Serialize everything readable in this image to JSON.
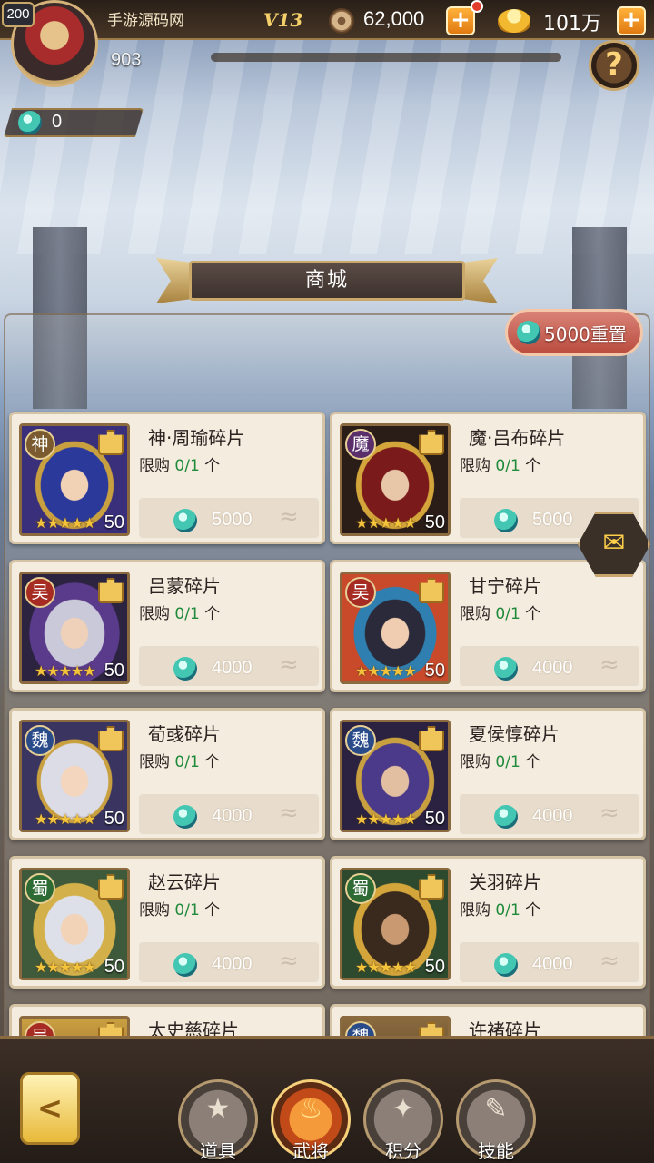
{
  "header": {
    "level": "200",
    "player_name": "手游源码网",
    "vip": "V13",
    "coins": "62,000",
    "ingots": "101万",
    "power": "903",
    "help_label": "?",
    "jade_balance": "0"
  },
  "title": "商城",
  "reset_button": "5000重置",
  "cards": [
    {
      "name": "神·周瑜碎片",
      "faction": "神",
      "limit_prefix": "限购",
      "limit_value": "0/1",
      "limit_suffix": "个",
      "stars": "★★★★★",
      "count": "50",
      "price": "5000"
    },
    {
      "name": "魔·吕布碎片",
      "faction": "魔",
      "limit_prefix": "限购",
      "limit_value": "0/1",
      "limit_suffix": "个",
      "stars": "★★★★★",
      "count": "50",
      "price": "5000"
    },
    {
      "name": "吕蒙碎片",
      "faction": "吴",
      "limit_prefix": "限购",
      "limit_value": "0/1",
      "limit_suffix": "个",
      "stars": "★★★★★",
      "count": "50",
      "price": "4000"
    },
    {
      "name": "甘宁碎片",
      "faction": "吴",
      "limit_prefix": "限购",
      "limit_value": "0/1",
      "limit_suffix": "个",
      "stars": "★★★★★",
      "count": "50",
      "price": "4000"
    },
    {
      "name": "荀彧碎片",
      "faction": "魏",
      "limit_prefix": "限购",
      "limit_value": "0/1",
      "limit_suffix": "个",
      "stars": "★★★★★",
      "count": "50",
      "price": "4000"
    },
    {
      "name": "夏侯惇碎片",
      "faction": "魏",
      "limit_prefix": "限购",
      "limit_value": "0/1",
      "limit_suffix": "个",
      "stars": "★★★★★",
      "count": "50",
      "price": "4000"
    },
    {
      "name": "赵云碎片",
      "faction": "蜀",
      "limit_prefix": "限购",
      "limit_value": "0/1",
      "limit_suffix": "个",
      "stars": "★★★★★",
      "count": "50",
      "price": "4000"
    },
    {
      "name": "关羽碎片",
      "faction": "蜀",
      "limit_prefix": "限购",
      "limit_value": "0/1",
      "limit_suffix": "个",
      "stars": "★★★★★",
      "count": "50",
      "price": "4000"
    },
    {
      "name": "太史慈碎片",
      "faction": "吴"
    },
    {
      "name": "许褚碎片",
      "faction": "魏"
    }
  ],
  "tabs": [
    {
      "label": "道具",
      "icon": "star-icon"
    },
    {
      "label": "武将",
      "icon": "flame-icon"
    },
    {
      "label": "积分",
      "icon": "crest-icon"
    },
    {
      "label": "技能",
      "icon": "scroll-icon"
    }
  ],
  "colors": {
    "accent_gold": "#c9a86a",
    "limit_green": "#1f8a3a",
    "reset_red": "#b94c3f",
    "active_tab": "#c24a18"
  }
}
